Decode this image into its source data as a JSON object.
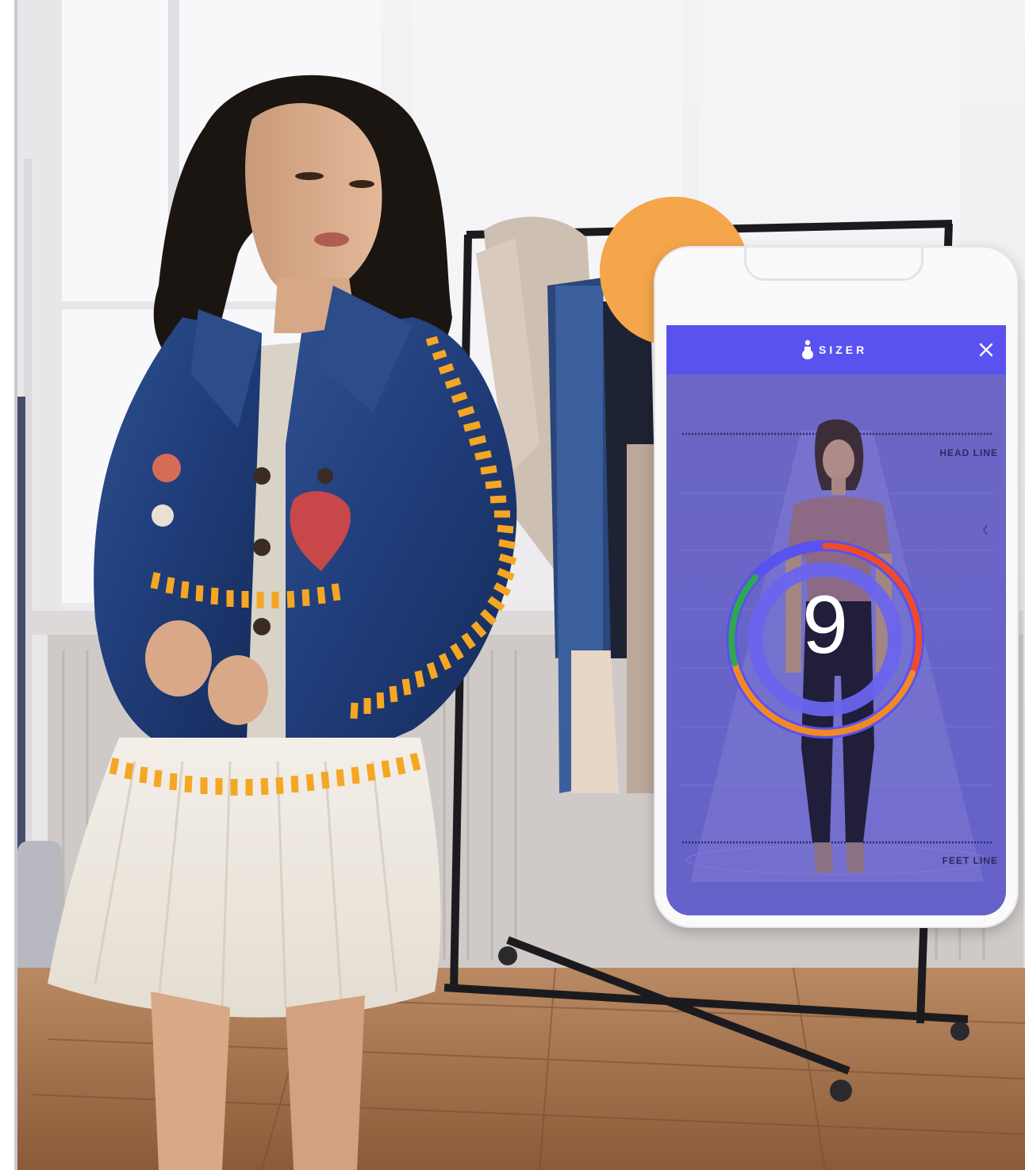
{
  "app": {
    "brand_name": "SIZER",
    "close_icon": "close-icon",
    "logo_icon": "sizer-person-logo-icon"
  },
  "camera": {
    "head_line_label": "HEAD LINE",
    "feet_line_label": "FEET LINE",
    "countdown": "9",
    "countdown_ring_colors": [
      "#5a52ee",
      "#f04a2a",
      "#f28a23",
      "#2fa84f"
    ]
  },
  "scene": {
    "measure_mark_color": "#f5a623",
    "accent_circle_color": "#f5a64a"
  }
}
